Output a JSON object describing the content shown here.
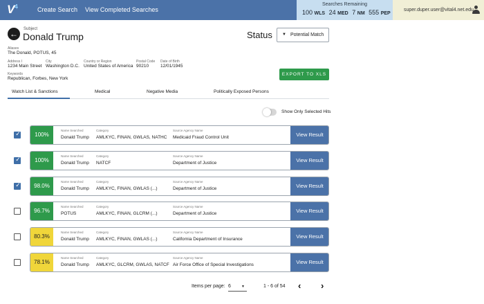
{
  "app": {
    "logo": "V",
    "logo_sup": "4"
  },
  "nav": {
    "create_search": "Create Search",
    "view_completed": "View Completed Searches"
  },
  "quota": {
    "title": "Searches Remaining",
    "items": [
      {
        "count": "100",
        "code": "WLS"
      },
      {
        "count": "24",
        "code": "MED"
      },
      {
        "count": "7",
        "code": "NM"
      },
      {
        "count": "555",
        "code": "PEP"
      }
    ]
  },
  "user": {
    "email": "super.duper.user@vital4.net.edu",
    "icon": "user-icon"
  },
  "subject": {
    "label": "Subject",
    "name": "Donald Trump",
    "aliases_label": "Aliases",
    "aliases": "The Donald, POTUS, 45",
    "address_label": "Address I",
    "address": "1234 Main Street",
    "city_label": "City",
    "city": "Washington D.C.",
    "country_label": "Country or Region",
    "country": "United States of America",
    "postcode_label": "Postal Code",
    "postcode": "90210",
    "dob_label": "Date of Birth",
    "dob": "12/01/1945",
    "keywords_label": "Keywords",
    "keywords": "Republican, Forbes, New York"
  },
  "status": {
    "label": "Status",
    "value": "Potential Match"
  },
  "export_label": "EXPORT TO XLS",
  "tabs": [
    {
      "label": "Watch List & Sanctions",
      "active": true
    },
    {
      "label": "Medical",
      "active": false
    },
    {
      "label": "Negative Media",
      "active": false
    },
    {
      "label": "Politically Exposed Persons",
      "active": false
    }
  ],
  "toggle": {
    "label": "Show Only Selected Hits",
    "on": false
  },
  "field_labels": {
    "name": "Name Searched",
    "category": "Category",
    "source": "Source Agency Name"
  },
  "view_label": "View Result",
  "colors": {
    "green": "#2e9a4b",
    "yellow": "#f0d63a",
    "blue": "#4b72a8"
  },
  "results": [
    {
      "checked": true,
      "score": "100%",
      "level": "green",
      "name": "Donald Trump",
      "category": "AMLKYC, FINAN, GWLAS, NATHC",
      "source": "Medicaid Fraud Control Unit"
    },
    {
      "checked": true,
      "score": "100%",
      "level": "green",
      "name": "Donald Trump",
      "category": "NATCF",
      "source": "Department of Justice"
    },
    {
      "checked": true,
      "score": "98.0%",
      "level": "green",
      "name": "Donald Trump",
      "category": "AMLKYC, FINAN, GWLAS (...)",
      "source": "Department of Justice"
    },
    {
      "checked": false,
      "score": "96.7%",
      "level": "green",
      "name": "POTUS",
      "category": "AMLKYC, FINAN, GLCRM (...)",
      "source": "Department of Justice"
    },
    {
      "checked": false,
      "score": "80.3%",
      "level": "yellow",
      "name": "Donald Trump",
      "category": "AMLKYC, FINAN, GWLAS (...)",
      "source": "California Department of Insurance"
    },
    {
      "checked": false,
      "score": "78.1%",
      "level": "yellow",
      "name": "Donald Trump",
      "category": "AMLKYC, GLCRM, GWLAS, NATCF",
      "source": "Air Force Office of Special Investigations"
    }
  ],
  "pagination": {
    "label": "Items per page:",
    "per_page": "6",
    "range": "1 - 6 of 54",
    "prev": "‹",
    "next": "›"
  }
}
